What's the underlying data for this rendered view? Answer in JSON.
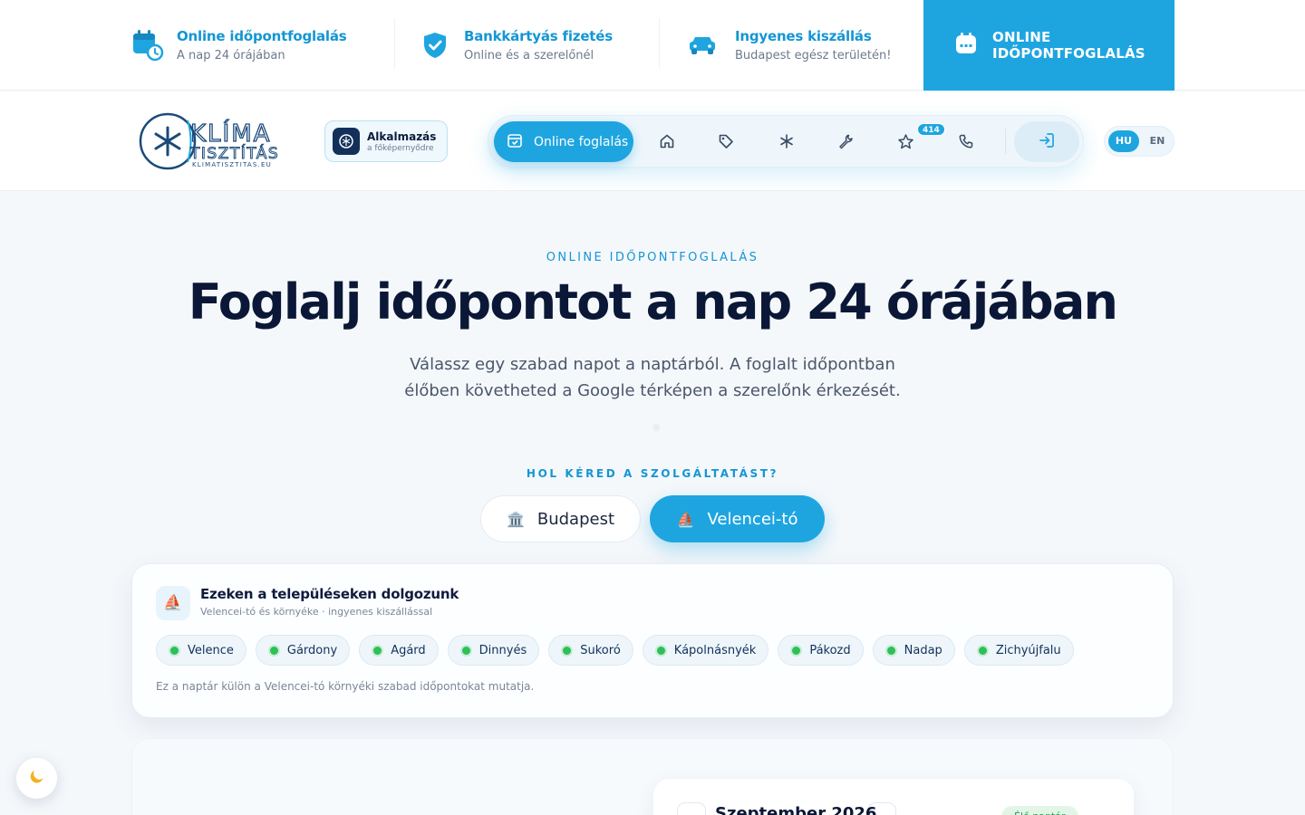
{
  "topbar": {
    "features": [
      {
        "title": "Online időpontfoglalás",
        "subtitle": "A nap 24 órájában",
        "icon": "calendar-clock-icon"
      },
      {
        "title": "Bankkártyás fizetés",
        "subtitle": "Online és a szerelőnél",
        "icon": "shield-check-icon"
      },
      {
        "title": "Ingyenes kiszállás",
        "subtitle": "Budapest egész területén!",
        "icon": "car-icon"
      }
    ],
    "cta_line1": "ONLINE",
    "cta_line2": "IDŐPONTFOGLALÁS"
  },
  "nav": {
    "logo_word1": "KLÍMA",
    "logo_word2": "TISZTÍTÁS",
    "logo_domain": "KLIMATISZTITAS.EU",
    "app_title": "Alkalmazás",
    "app_subtitle": "a főképernyődre",
    "book_label": "Online foglalás",
    "reviews_count": "414",
    "lang_hu": "HU",
    "lang_en": "EN",
    "icons": [
      "home-icon",
      "tag-icon",
      "snowflake-icon",
      "wrench-icon",
      "star-icon",
      "phone-icon",
      "login-icon"
    ]
  },
  "hero": {
    "eyebrow": "ONLINE IDŐPONTFOGLALÁS",
    "title": "Foglalj időpontot a nap 24 órájában",
    "subtitle": "Válassz egy szabad napot a naptárból. A foglalt időpontban élőben követheted a Google térképen a szerelőnk érkezését."
  },
  "location": {
    "question": "HOL KÉRED A SZOLGÁLTATÁST?",
    "budapest_label": "Budapest",
    "budapest_emoji": "🏛️",
    "velence_label": "Velencei-tó",
    "velence_emoji": "⛵",
    "selected": "Velencei-tó"
  },
  "towns_card": {
    "emoji": "⛵",
    "title": "Ezeken a településeken dolgozunk",
    "subtitle": "Velencei-tó és környéke · ingyenes kiszállással",
    "towns": [
      "Velence",
      "Gárdony",
      "Agárd",
      "Dinnyés",
      "Sukoró",
      "Kápolnásnyék",
      "Pákozd",
      "Nadap",
      "Zichyújfalu"
    ],
    "note": "Ez a naptár külön a Velencei-tó környéki szabad időpontokat mutatja."
  },
  "calendar": {
    "month": "Szeptember 2026",
    "status": "Élő naptár"
  },
  "theme_toggle_icon": "moon-icon",
  "colors": {
    "accent": "#1ea5e0",
    "accent_text": "#1496d4",
    "heading": "#0b1736",
    "available_dot": "#2cbf5a"
  }
}
